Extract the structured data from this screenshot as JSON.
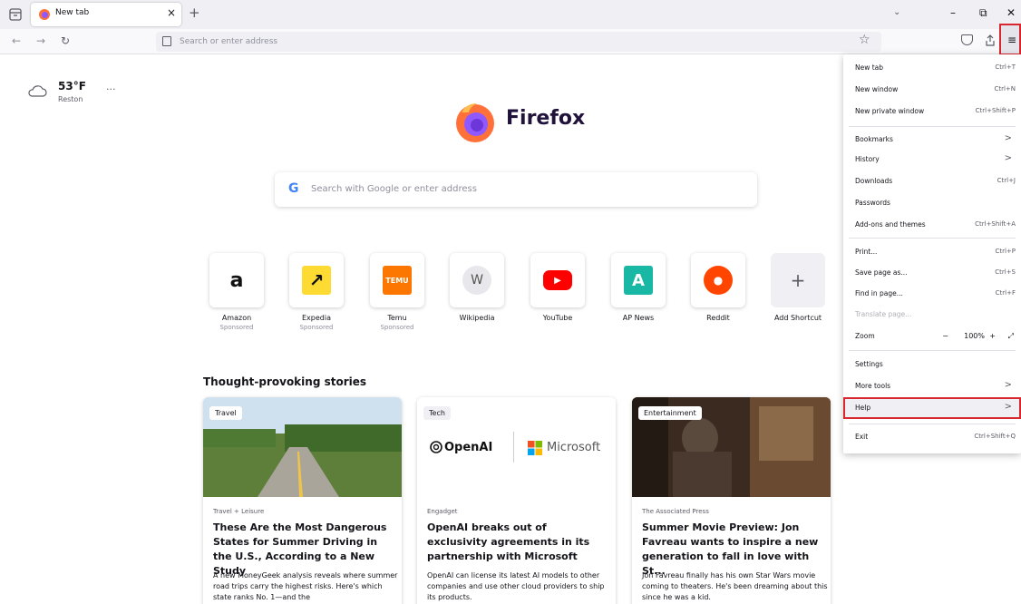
{
  "colors": {
    "highlight": "#d7262e",
    "accent": "#4285f4"
  },
  "tab": {
    "title": "New tab",
    "close": "×"
  },
  "tabstrip": {
    "new_tab": "+",
    "overflow": "⌄"
  },
  "window_controls": {
    "minimize": "–",
    "restore": "⧉",
    "close": "✕"
  },
  "nav": {
    "back": "←",
    "forward": "→",
    "reload": "↻"
  },
  "urlbar": {
    "placeholder": "Search or enter address"
  },
  "toolbar": {
    "bookmark_star": "☆",
    "menu": "≡"
  },
  "weather": {
    "temp": "53°F",
    "location": "Reston",
    "more": "···"
  },
  "brand": {
    "wordmark": "Firefox"
  },
  "search": {
    "g": "G",
    "placeholder": "Search with Google or enter address"
  },
  "shortcuts": [
    {
      "name": "Amazon",
      "sponsored": "Sponsored",
      "glyph": "a"
    },
    {
      "name": "Expedia",
      "sponsored": "Sponsored",
      "glyph": "↗"
    },
    {
      "name": "Temu",
      "sponsored": "Sponsored",
      "glyph": "TEMU"
    },
    {
      "name": "Wikipedia",
      "sponsored": "",
      "glyph": "W"
    },
    {
      "name": "YouTube",
      "sponsored": "",
      "glyph": "▶"
    },
    {
      "name": "AP News",
      "sponsored": "",
      "glyph": "A"
    },
    {
      "name": "Reddit",
      "sponsored": "",
      "glyph": "●"
    },
    {
      "name": "Add Shortcut",
      "sponsored": "",
      "glyph": "+"
    }
  ],
  "stories": {
    "title": "Thought-provoking stories",
    "cards": [
      {
        "tag": "Travel",
        "source": "Travel + Leisure",
        "title": "These Are the Most Dangerous States for Summer Driving in the U.S., According to a New Study",
        "desc": "A new MoneyGeek analysis reveals where summer road trips carry the highest risks. Here's which state ranks No. 1—and the"
      },
      {
        "tag": "Tech",
        "source": "Engadget",
        "title": "OpenAI breaks out of exclusivity agreements in its partnership with Microsoft",
        "desc": "OpenAI can license its latest AI models to other companies and use other cloud providers to ship its products.",
        "logo_left": "OpenAI",
        "logo_right": "Microsoft"
      },
      {
        "tag": "Entertainment",
        "source": "The Associated Press",
        "title": "Summer Movie Preview: Jon Favreau wants to inspire a new generation to fall in love with St...",
        "desc": "Jon Favreau finally has his own Star Wars movie coming to theaters. He's been dreaming about this since he was a kid."
      }
    ]
  },
  "menu": {
    "new_tab": {
      "label": "New tab",
      "key": "Ctrl+T"
    },
    "new_window": {
      "label": "New window",
      "key": "Ctrl+N"
    },
    "new_private": {
      "label": "New private window",
      "key": "Ctrl+Shift+P"
    },
    "bookmarks": {
      "label": "Bookmarks",
      "arrow": ">"
    },
    "history": {
      "label": "History",
      "arrow": ">"
    },
    "downloads": {
      "label": "Downloads",
      "key": "Ctrl+J"
    },
    "passwords": {
      "label": "Passwords"
    },
    "addons": {
      "label": "Add-ons and themes",
      "key": "Ctrl+Shift+A"
    },
    "print": {
      "label": "Print...",
      "key": "Ctrl+P"
    },
    "save_page": {
      "label": "Save page as...",
      "key": "Ctrl+S"
    },
    "find": {
      "label": "Find in page...",
      "key": "Ctrl+F"
    },
    "translate": {
      "label": "Translate page..."
    },
    "zoom": {
      "label": "Zoom",
      "minus": "−",
      "value": "100%",
      "plus": "+",
      "fullscreen": "⤢"
    },
    "settings": {
      "label": "Settings"
    },
    "more_tools": {
      "label": "More tools",
      "arrow": ">"
    },
    "help": {
      "label": "Help",
      "arrow": ">"
    },
    "exit": {
      "label": "Exit",
      "key": "Ctrl+Shift+Q"
    }
  }
}
